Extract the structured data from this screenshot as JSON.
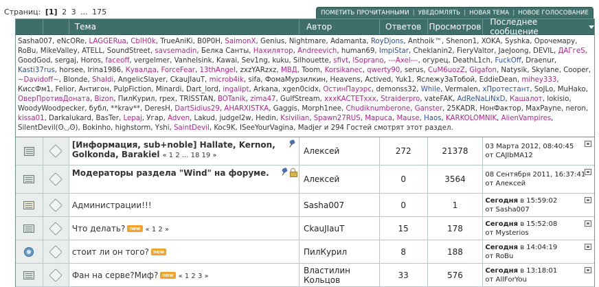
{
  "pager": {
    "label": "Страниц:",
    "current": "[1]",
    "pages": [
      "2",
      "3",
      "...",
      "175"
    ]
  },
  "actions": [
    "ПОМЕТИТЬ ПРОЧИТАННЫМИ",
    "УВЕДОМЛЯТЬ",
    "НОВАЯ ТЕМА",
    "НОВОЕ ГОЛОСОВАНИЕ"
  ],
  "columns": {
    "topic": "Тема",
    "author": "Автор",
    "replies": "Ответов",
    "views": "Просмотров",
    "last": "Последнее сообщение"
  },
  "online": {
    "users": [
      {
        "n": "Sasha007",
        "c": "#333333"
      },
      {
        "n": "eNcORe",
        "c": "#333333"
      },
      {
        "n": "LAGGERua",
        "c": "#b4238c"
      },
      {
        "n": "CblH0k",
        "c": "#b4238c"
      },
      {
        "n": "TrueAniKi",
        "c": "#333333"
      },
      {
        "n": "B0P0H",
        "c": "#333333"
      },
      {
        "n": "SaimonX",
        "c": "#b4238c"
      },
      {
        "n": "Genius",
        "c": "#333333"
      },
      {
        "n": "Nightmare",
        "c": "#333333"
      },
      {
        "n": "Adamanta",
        "c": "#333333"
      },
      {
        "n": "RoyDjons",
        "c": "#2750a8"
      },
      {
        "n": "Anthoik™",
        "c": "#333333"
      },
      {
        "n": "Shenon1",
        "c": "#333333"
      },
      {
        "n": "XOKA",
        "c": "#333333"
      },
      {
        "n": "Syshka",
        "c": "#333333"
      },
      {
        "n": "Орочемару",
        "c": "#333333"
      },
      {
        "n": "RoBu",
        "c": "#333333"
      },
      {
        "n": "MikeValley",
        "c": "#333333"
      },
      {
        "n": "ATELL",
        "c": "#333333"
      },
      {
        "n": "SoundStreet",
        "c": "#333333"
      },
      {
        "n": "savsemadin",
        "c": "#b4238c"
      },
      {
        "n": "Белка Санты",
        "c": "#333333"
      },
      {
        "n": "Нахилятор",
        "c": "#b4238c"
      },
      {
        "n": "Andreevich",
        "c": "#b4238c"
      },
      {
        "n": "human69",
        "c": "#333333"
      },
      {
        "n": "ImpiStar",
        "c": "#2750a8"
      },
      {
        "n": "Cheklanin2",
        "c": "#333333"
      },
      {
        "n": "FieryValtor",
        "c": "#333333"
      },
      {
        "n": "JaeJoong",
        "c": "#333333"
      },
      {
        "n": "DEVIL",
        "c": "#333333"
      },
      {
        "n": "ДАГгеS",
        "c": "#b4238c"
      },
      {
        "n": "GoodGod",
        "c": "#333333"
      },
      {
        "n": "sergaj",
        "c": "#333333"
      },
      {
        "n": "Horos",
        "c": "#333333"
      },
      {
        "n": "faceoff",
        "c": "#b4238c"
      },
      {
        "n": "vergelmer",
        "c": "#333333"
      },
      {
        "n": "Vanhelsink",
        "c": "#333333"
      },
      {
        "n": "Kawai",
        "c": "#333333"
      },
      {
        "n": "Sev1ng",
        "c": "#333333"
      },
      {
        "n": "kuku",
        "c": "#333333"
      },
      {
        "n": "Silhouette",
        "c": "#333333"
      },
      {
        "n": "sfivt",
        "c": "#b4238c"
      },
      {
        "n": "lSoprano",
        "c": "#b4238c"
      },
      {
        "n": "---Axel---",
        "c": "#b4238c"
      },
      {
        "n": "огурец",
        "c": "#333333"
      },
      {
        "n": "DeathL1ch",
        "c": "#333333"
      },
      {
        "n": "FuckOff",
        "c": "#2750a8"
      },
      {
        "n": "Draenur",
        "c": "#333333"
      },
      {
        "n": "Kasti37rus",
        "c": "#2750a8"
      },
      {
        "n": "horsee",
        "c": "#333333"
      },
      {
        "n": "Irina1986",
        "c": "#333333"
      },
      {
        "n": "Кувалда",
        "c": "#b4238c"
      },
      {
        "n": "ForceFear",
        "c": "#b4238c"
      },
      {
        "n": "13thAngeI",
        "c": "#b4238c"
      },
      {
        "n": "zxzYARzxz",
        "c": "#333333"
      },
      {
        "n": "МВД",
        "c": "#b4238c"
      },
      {
        "n": "Toom",
        "c": "#333333"
      },
      {
        "n": "Korsikanec",
        "c": "#b4238c"
      },
      {
        "n": "qwerty90",
        "c": "#b4238c"
      },
      {
        "n": "serus",
        "c": "#333333"
      },
      {
        "n": "CuM6uozZ",
        "c": "#b4238c"
      },
      {
        "n": "Gigafon",
        "c": "#b4238c"
      },
      {
        "n": "Natysik",
        "c": "#333333"
      },
      {
        "n": "Skylane",
        "c": "#333333"
      },
      {
        "n": "Cooper",
        "c": "#333333"
      },
      {
        "n": "~Davidoff~",
        "c": "#b4238c"
      },
      {
        "n": "Blonde",
        "c": "#333333"
      },
      {
        "n": "Shaldi",
        "c": "#b4238c"
      },
      {
        "n": "AngelicSlayer",
        "c": "#333333"
      },
      {
        "n": "CkauJIauT",
        "c": "#333333"
      },
      {
        "n": "microb4ik",
        "c": "#b4238c"
      },
      {
        "n": "sifa",
        "c": "#333333"
      },
      {
        "n": "ФомаМурзилкин",
        "c": "#333333"
      },
      {
        "n": "Heavens",
        "c": "#333333"
      },
      {
        "n": "Actived",
        "c": "#333333"
      },
      {
        "n": "Yuk1",
        "c": "#333333"
      },
      {
        "n": "ЯслежуЗаТобой",
        "c": "#333333"
      },
      {
        "n": "EddieDean",
        "c": "#333333"
      },
      {
        "n": "mihey333",
        "c": "#b4238c"
      },
      {
        "n": "КиссФм1",
        "c": "#333333"
      },
      {
        "n": "Felior",
        "c": "#333333"
      },
      {
        "n": "Антигон",
        "c": "#333333"
      },
      {
        "n": "PulpFiction",
        "c": "#333333"
      },
      {
        "n": "Minardi",
        "c": "#333333"
      },
      {
        "n": "Dart_lord",
        "c": "#333333"
      },
      {
        "n": "ingalipt",
        "c": "#b4238c"
      },
      {
        "n": "Arkana",
        "c": "#333333"
      },
      {
        "n": "xgen0cidx",
        "c": "#333333"
      },
      {
        "n": "ОстинПауэрс",
        "c": "#b4238c"
      },
      {
        "n": "demonss32",
        "c": "#333333"
      },
      {
        "n": "While",
        "c": "#2750a8"
      },
      {
        "n": "Vermalen",
        "c": "#333333"
      },
      {
        "n": "хПротестант",
        "c": "#2750a8"
      },
      {
        "n": "SoJLo",
        "c": "#333333"
      },
      {
        "n": "MuHako",
        "c": "#333333"
      },
      {
        "n": "ОверПротивДоната",
        "c": "#b4238c"
      },
      {
        "n": "Bizon",
        "c": "#b4238c"
      },
      {
        "n": "ПилКурил",
        "c": "#333333"
      },
      {
        "n": "rpex",
        "c": "#333333"
      },
      {
        "n": "TRISSTAN",
        "c": "#333333"
      },
      {
        "n": "BOTanik",
        "c": "#b4238c"
      },
      {
        "n": "zima47",
        "c": "#b4238c"
      },
      {
        "n": "GulfStream",
        "c": "#333333"
      },
      {
        "n": "xxxKACTETxxx",
        "c": "#b4238c"
      },
      {
        "n": "Straiderpro",
        "c": "#b4238c"
      },
      {
        "n": "vateFAK",
        "c": "#333333"
      },
      {
        "n": "AdReNaLiNxD",
        "c": "#2750a8"
      },
      {
        "n": "Кашалот",
        "c": "#b4238c"
      },
      {
        "n": "lokisio",
        "c": "#333333"
      },
      {
        "n": "WoodyWoodpecker",
        "c": "#333333"
      },
      {
        "n": "бубл",
        "c": "#333333"
      },
      {
        "n": "**krav**",
        "c": "#333333"
      },
      {
        "n": "DeresH",
        "c": "#333333"
      },
      {
        "n": "DartSidius29",
        "c": "#b4238c"
      },
      {
        "n": "AHARXISTKA",
        "c": "#b4238c"
      },
      {
        "n": "Gaggis",
        "c": "#333333"
      },
      {
        "n": "Morph1nee",
        "c": "#333333"
      },
      {
        "n": "Chudiknumberone",
        "c": "#b4238c"
      },
      {
        "n": "Ganster",
        "c": "#b4238c"
      },
      {
        "n": "25KADR",
        "c": "#333333"
      },
      {
        "n": "НонФактор",
        "c": "#333333"
      },
      {
        "n": "MaxPayne",
        "c": "#333333"
      },
      {
        "n": "neron",
        "c": "#333333"
      },
      {
        "n": "kissa01",
        "c": "#b4238c"
      },
      {
        "n": "Darkalukard",
        "c": "#333333"
      },
      {
        "n": "BasTer",
        "c": "#333333"
      },
      {
        "n": "Lepaj",
        "c": "#b4238c"
      },
      {
        "n": "Угар",
        "c": "#333333"
      },
      {
        "n": "Adven",
        "c": "#b4238c"
      },
      {
        "n": "Lakud",
        "c": "#333333"
      },
      {
        "n": "judgel2w",
        "c": "#333333"
      },
      {
        "n": "Hedin",
        "c": "#333333"
      },
      {
        "n": "Ksivilian",
        "c": "#b4238c"
      },
      {
        "n": "Spawn27RUS",
        "c": "#b4238c"
      },
      {
        "n": "Mapuca",
        "c": "#b4238c"
      },
      {
        "n": "Mause",
        "c": "#b4238c"
      },
      {
        "n": "Haos",
        "c": "#2750a8"
      },
      {
        "n": "KARKOLOMNIK",
        "c": "#b4238c"
      },
      {
        "n": "AlienVampires",
        "c": "#b4238c"
      },
      {
        "n": "SilentDevil(ʘ◡ʘ)",
        "c": "#333333"
      },
      {
        "n": "Bokinho",
        "c": "#333333"
      },
      {
        "n": "highstorm",
        "c": "#333333"
      },
      {
        "n": "Yshi",
        "c": "#333333"
      },
      {
        "n": "SaintDevil",
        "c": "#b4238c"
      },
      {
        "n": "Koc9K",
        "c": "#333333"
      },
      {
        "n": "ISeeYourVagina",
        "c": "#333333"
      },
      {
        "n": "Madjer",
        "c": "#333333"
      }
    ],
    "tail": "и 294 Гостей смотрят этот раздел."
  },
  "topics": [
    {
      "title": "[Информация, sub+noble] Hallate, Kernon, Golkonda, Barakiel",
      "bold": true,
      "isNew": false,
      "pages": "« 1 2 ... 18 19 »",
      "pinned": true,
      "locked": false,
      "icon": "big",
      "author": "Алексей",
      "replies": "272",
      "views": "21378",
      "last_time": "03 Марта 2012, 08:40:45",
      "last_prefix": "",
      "last_by_label": "от",
      "last_by": "CAJIbMA12",
      "tall": true
    },
    {
      "title": "Модераторы раздела \"Wind\" на форуме.",
      "bold": true,
      "isNew": false,
      "pages": "",
      "pinned": true,
      "locked": true,
      "icon": "normal",
      "author": "Алексей",
      "replies": "0",
      "views": "3564",
      "last_time": "08 Сентября 2011, 16:37:41",
      "last_prefix": "",
      "last_by_label": "от",
      "last_by": "Алексей",
      "tall": true
    },
    {
      "title": "Администрации!!!",
      "bold": false,
      "isNew": false,
      "pages": "",
      "pinned": false,
      "locked": false,
      "icon": "poll",
      "author": "Sasha007",
      "replies": "0",
      "views": "1",
      "last_time": "в 15:59:02",
      "last_prefix": "Сегодня",
      "last_by_label": "от",
      "last_by": "Sasha007",
      "tall": false
    },
    {
      "title": "Что делать?",
      "bold": false,
      "isNew": true,
      "pages": "« 1 2 »",
      "pinned": false,
      "locked": false,
      "icon": "normal",
      "author": "CkauJIauT",
      "replies": "15",
      "views": "178",
      "last_time": "в 15:52:08",
      "last_prefix": "Сегодня",
      "last_by_label": "от",
      "last_by": "Mysterios",
      "tall": false
    },
    {
      "title": "стоит ли он того?",
      "bold": false,
      "isNew": true,
      "pages": "",
      "pinned": false,
      "locked": false,
      "icon": "globe",
      "author": "ПилКурил",
      "replies": "8",
      "views": "188",
      "last_time": "в 14:04:19",
      "last_prefix": "Сегодня",
      "last_by_label": "от",
      "last_by": "RoBu",
      "tall": false
    },
    {
      "title": "Фан на серве?Миф?",
      "bold": false,
      "isNew": true,
      "pages": "« 1 2 3 »",
      "pinned": false,
      "locked": false,
      "icon": "normal",
      "author": "Властилин Кольцов",
      "replies": "33",
      "views": "576",
      "last_time": "в 13:18:01",
      "last_prefix": "Сегодня",
      "last_by_label": "от",
      "last_by": "AllForYou",
      "tall": false
    }
  ],
  "new_badge": "new",
  "colors": {
    "header": "#3f6f6a",
    "moderator": "#b4238c",
    "admin": "#2750a8"
  }
}
